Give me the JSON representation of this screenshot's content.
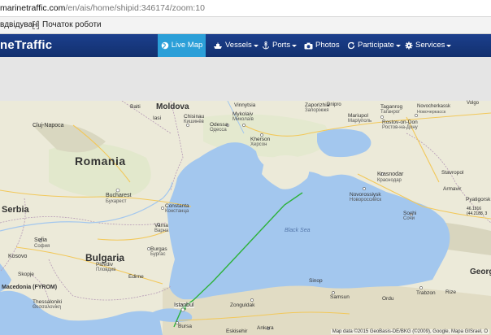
{
  "browser": {
    "url_domain": "marinetraffic.com",
    "url_path": "/en/ais/home/shipid:346174/zoom:10",
    "bookmarks": [
      {
        "label": "вдвідувані"
      },
      {
        "label": "Початок роботи"
      }
    ]
  },
  "nav": {
    "brand": "neTraffic",
    "items": [
      {
        "label": "Live Map",
        "icon": "globe-icon",
        "active": true,
        "caret": false
      },
      {
        "label": "Vessels",
        "icon": "ship-icon",
        "active": false,
        "caret": true
      },
      {
        "label": "Ports",
        "icon": "anchor-icon",
        "active": false,
        "caret": true
      },
      {
        "label": "Photos",
        "icon": "camera-icon",
        "active": false,
        "caret": false
      },
      {
        "label": "Participate",
        "icon": "refresh-icon",
        "active": false,
        "caret": true
      },
      {
        "label": "Services",
        "icon": "gear-icon",
        "active": false,
        "caret": true
      }
    ]
  },
  "map": {
    "sea_label": "Black Sea",
    "ship_track_color": "#2db23a",
    "coords_lines": [
      "46.1916",
      "(44.2188, 3"
    ],
    "attribution": "Map data ©2015 GeoBasis-DE/BKG (©2009), Google, Mapa GISrael, O",
    "countries": [
      {
        "label": "Moldova"
      },
      {
        "label": "Romania"
      },
      {
        "label": "Serbia"
      },
      {
        "label": "Bulgaria"
      },
      {
        "label": "Macedonia (FYROM)"
      },
      {
        "label": "Kosovo"
      },
      {
        "label": "Georg"
      }
    ],
    "cities": [
      {
        "label": "Cluj-Napoca"
      },
      {
        "label": "Bucharest"
      },
      {
        "label": "Бухарест"
      },
      {
        "label": "Constanta"
      },
      {
        "label": "Констанца"
      },
      {
        "label": "Varna"
      },
      {
        "label": "Варна"
      },
      {
        "label": "Sofia"
      },
      {
        "label": "София"
      },
      {
        "label": "Burgas"
      },
      {
        "label": "Бургас"
      },
      {
        "label": "Plovdiv"
      },
      {
        "label": "Пловдив"
      },
      {
        "label": "Skopje"
      },
      {
        "label": "Thessaloniki"
      },
      {
        "label": "Θεσσαλονίκη"
      },
      {
        "label": "Edirne"
      },
      {
        "label": "Istanbul"
      },
      {
        "label": "Bursa"
      },
      {
        "label": "Eskisehir"
      },
      {
        "label": "Ankara"
      },
      {
        "label": "Zonguldak"
      },
      {
        "label": "Samsun"
      },
      {
        "label": "Trabzon"
      },
      {
        "label": "Rize"
      },
      {
        "label": "Sinop"
      },
      {
        "label": "Ordu"
      },
      {
        "label": "Odessa"
      },
      {
        "label": "Одесса"
      },
      {
        "label": "Mykolaiv"
      },
      {
        "label": "Миколаїв"
      },
      {
        "label": "Kherson"
      },
      {
        "label": "Херсон"
      },
      {
        "label": "Zaporizhia"
      },
      {
        "label": "Запоріжжя"
      },
      {
        "label": "Mariupol"
      },
      {
        "label": "Маріуполь"
      },
      {
        "label": "Taganrog"
      },
      {
        "label": "Таганрог"
      },
      {
        "label": "Rostov-on-Don"
      },
      {
        "label": "Ростов-на-Дону"
      },
      {
        "label": "Novocherkassk"
      },
      {
        "label": "Новочеркасск"
      },
      {
        "label": "Krasnodar"
      },
      {
        "label": "Краснодар"
      },
      {
        "label": "Novorossiysk"
      },
      {
        "label": "Новороссийск"
      },
      {
        "label": "Sochi"
      },
      {
        "label": "Сочи"
      },
      {
        "label": "Stavropol"
      },
      {
        "label": "Pyatigorsk"
      },
      {
        "label": "Balti"
      },
      {
        "label": "Iasi"
      },
      {
        "label": "Chisinau"
      },
      {
        "label": "Кишинёв"
      },
      {
        "label": "Vinnytsia"
      },
      {
        "label": "Dnipro"
      },
      {
        "label": "Armavir"
      },
      {
        "label": "Volgo"
      }
    ]
  }
}
